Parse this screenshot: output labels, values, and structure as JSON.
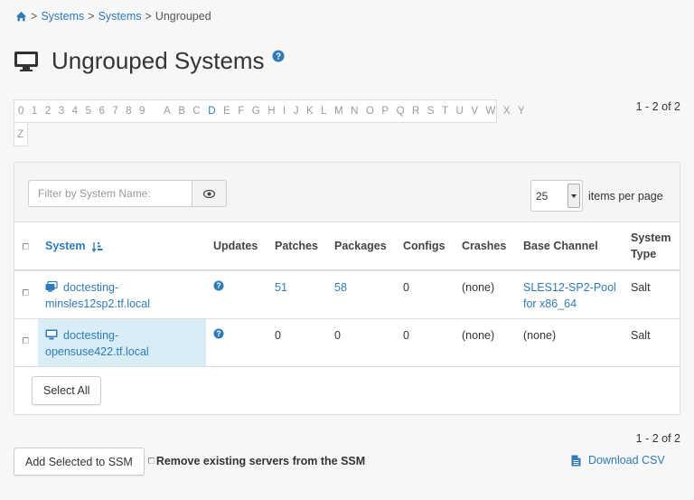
{
  "breadcrumb": {
    "items": [
      {
        "label": "Systems",
        "link": true
      },
      {
        "label": "Systems",
        "link": true
      },
      {
        "label": "Ungrouped",
        "link": false
      }
    ],
    "separator": ">"
  },
  "page": {
    "title": "Ungrouped Systems"
  },
  "alphabar": {
    "digits": [
      "0",
      "1",
      "2",
      "3",
      "4",
      "5",
      "6",
      "7",
      "8",
      "9"
    ],
    "letters": [
      "A",
      "B",
      "C",
      "D",
      "E",
      "F",
      "G",
      "H",
      "I",
      "J",
      "K",
      "L",
      "M",
      "N",
      "O",
      "P",
      "Q",
      "R",
      "S",
      "T",
      "U",
      "V",
      "W",
      "X",
      "Y"
    ],
    "overflow": [
      "Z"
    ],
    "active": [
      "D"
    ]
  },
  "pagination": {
    "top": "1 - 2 of 2",
    "bottom": "1 - 2 of 2"
  },
  "filter": {
    "placeholder": "Filter by System Name:"
  },
  "per_page": {
    "value": "25",
    "label": "items per page"
  },
  "table": {
    "columns": [
      "System",
      "Updates",
      "Patches",
      "Packages",
      "Configs",
      "Crashes",
      "Base Channel",
      "System Type"
    ],
    "rows": [
      {
        "icon": "virtual-system-icon",
        "system": "doctesting-minsles12sp2.tf.local",
        "patches": "51",
        "packages": "58",
        "configs": "0",
        "crashes": "(none)",
        "base_channel": "SLES12-SP2-Pool for x86_64",
        "system_type": "Salt",
        "highlight": false
      },
      {
        "icon": "desktop-icon",
        "system": "doctesting-opensuse422.tf.local",
        "patches": "0",
        "packages": "0",
        "configs": "0",
        "crashes": "(none)",
        "base_channel": "(none)",
        "system_type": "Salt",
        "highlight": true
      }
    ]
  },
  "buttons": {
    "select_all": "Select All",
    "add_to_ssm": "Add Selected to SSM",
    "remove_from_ssm": "Remove existing servers from the SSM",
    "download_csv": "Download CSV"
  },
  "colors": {
    "link": "#2e7bb8",
    "highlight": "#d9edf7",
    "background": "#f7f7f7"
  }
}
